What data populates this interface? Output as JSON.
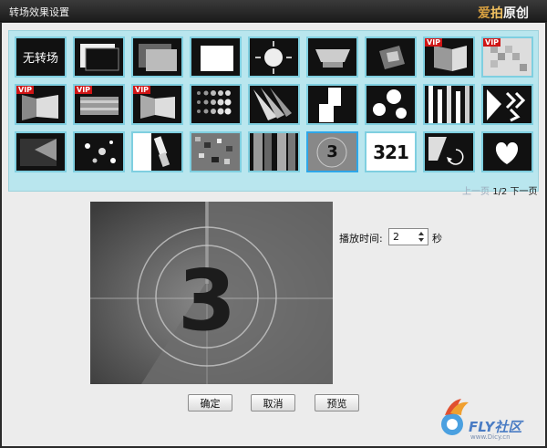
{
  "window": {
    "title": "转场效果设置"
  },
  "brand": {
    "part1": "爱",
    "part2": "拍",
    "part3": "原创"
  },
  "gallery": {
    "items": [
      {
        "id": "none",
        "label": "无转场",
        "vip": false
      },
      {
        "id": "t2",
        "vip": false
      },
      {
        "id": "t3",
        "vip": false
      },
      {
        "id": "t4",
        "vip": false
      },
      {
        "id": "t5",
        "vip": false
      },
      {
        "id": "t6",
        "vip": false
      },
      {
        "id": "t7",
        "vip": false
      },
      {
        "id": "t8",
        "vip": true
      },
      {
        "id": "t9",
        "vip": true
      },
      {
        "id": "t10",
        "vip": true
      },
      {
        "id": "t11",
        "vip": true
      },
      {
        "id": "t12",
        "vip": true
      },
      {
        "id": "t13",
        "vip": false
      },
      {
        "id": "t14",
        "vip": false
      },
      {
        "id": "t15",
        "vip": false
      },
      {
        "id": "t16",
        "vip": false
      },
      {
        "id": "t17",
        "vip": false
      },
      {
        "id": "t18",
        "vip": false
      },
      {
        "id": "t19",
        "vip": false
      },
      {
        "id": "t20",
        "vip": false
      },
      {
        "id": "t21",
        "vip": false
      },
      {
        "id": "t22",
        "vip": false
      },
      {
        "id": "t23",
        "vip": false
      },
      {
        "id": "countdown",
        "label": "3",
        "vip": false,
        "selected": true
      },
      {
        "id": "t25",
        "label": "321",
        "vip": false
      },
      {
        "id": "t26",
        "vip": false
      },
      {
        "id": "t27",
        "vip": false
      }
    ],
    "vip_label": "VIP"
  },
  "pager": {
    "prev": "上一页",
    "current": "1",
    "total": "/2",
    "next": "下一页"
  },
  "preview": {
    "number": "3"
  },
  "duration": {
    "label": "播放时间:",
    "value": "2",
    "unit": "秒"
  },
  "buttons": {
    "ok": "确定",
    "cancel": "取消",
    "preview": "预览"
  },
  "watermark": {
    "text": "FLY社区",
    "sub": "www.Dicy.cn"
  }
}
